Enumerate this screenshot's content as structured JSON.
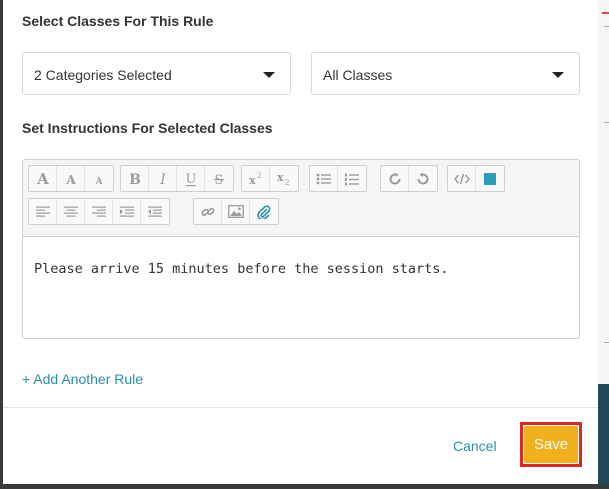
{
  "modal": {
    "section_classes_title": "Select Classes For This Rule",
    "category_select": {
      "value": "2 Categories Selected"
    },
    "class_select": {
      "value": "All Classes"
    },
    "section_instructions_title": "Set Instructions For Selected Classes",
    "editor": {
      "toolbar_icons": [
        "font-size-large-icon",
        "font-size-medium-icon",
        "font-size-small-icon",
        "bold-icon",
        "italic-icon",
        "underline-icon",
        "strikethrough-icon",
        "superscript-icon",
        "subscript-icon",
        "unordered-list-icon",
        "ordered-list-icon",
        "redo-icon",
        "undo-icon",
        "code-view-icon",
        "color-picker-icon",
        "align-left-icon",
        "align-center-icon",
        "align-right-icon",
        "indent-icon",
        "outdent-icon",
        "link-icon",
        "image-icon",
        "attachment-icon"
      ],
      "content": "Please arrive 15 minutes before the session starts."
    },
    "add_rule_link": "+ Add Another Rule",
    "cancel_label": "Cancel",
    "save_label": "Save"
  },
  "colors": {
    "accent": "#2a8ea8",
    "save_button": "#f2b01c",
    "highlight_border": "#e3261f",
    "color_swatch": "#2a9bb8"
  }
}
